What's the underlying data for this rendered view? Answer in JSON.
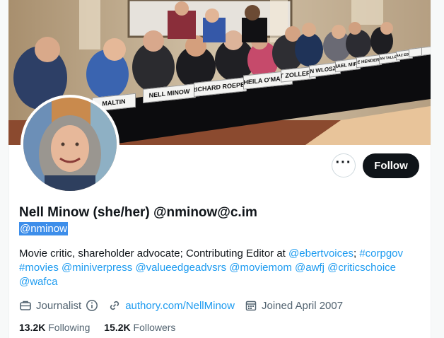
{
  "banner": {
    "placards": [
      "MALTIN",
      "NELL MINOW",
      "RICHARD ROEPER",
      "SHEILA O'MALLEY",
      "MATT ZOLLER SEITZ",
      "SUSAN WLOSZCZYNA",
      "MICHAEL MIRASOL",
      "ODIE HENDERSON",
      "BRIAN TALLERICO",
      "CHAZ EBERT",
      "",
      ""
    ]
  },
  "actions": {
    "more_glyph": "···",
    "follow_label": "Follow"
  },
  "profile": {
    "display_name": "Nell Minow (she/her) @nminow@c.im",
    "handle": "@nminow"
  },
  "bio": {
    "line1_text": "Movie critic, shareholder advocate; Contributing Editor at ",
    "line1_link1": "@ebertvoices",
    "line1_sep": "; ",
    "line1_link2": "#corpgov",
    "line2_links": [
      "#movies",
      "@miniverpress",
      "@valueedgeadvsrs",
      "@moviemom",
      "@awfj",
      "@criticschoice"
    ],
    "line3_link": "@wafca"
  },
  "meta": {
    "profession": "Journalist",
    "website": "authory.com/NellMinow",
    "joined": "Joined April 2007"
  },
  "stats": {
    "following_count": "13.2K",
    "following_label": "Following",
    "followers_count": "15.2K",
    "followers_label": "Followers"
  },
  "colors": {
    "link": "#1d9bf0",
    "follow_bg": "#0f1419",
    "selection": "#3d8eea"
  }
}
